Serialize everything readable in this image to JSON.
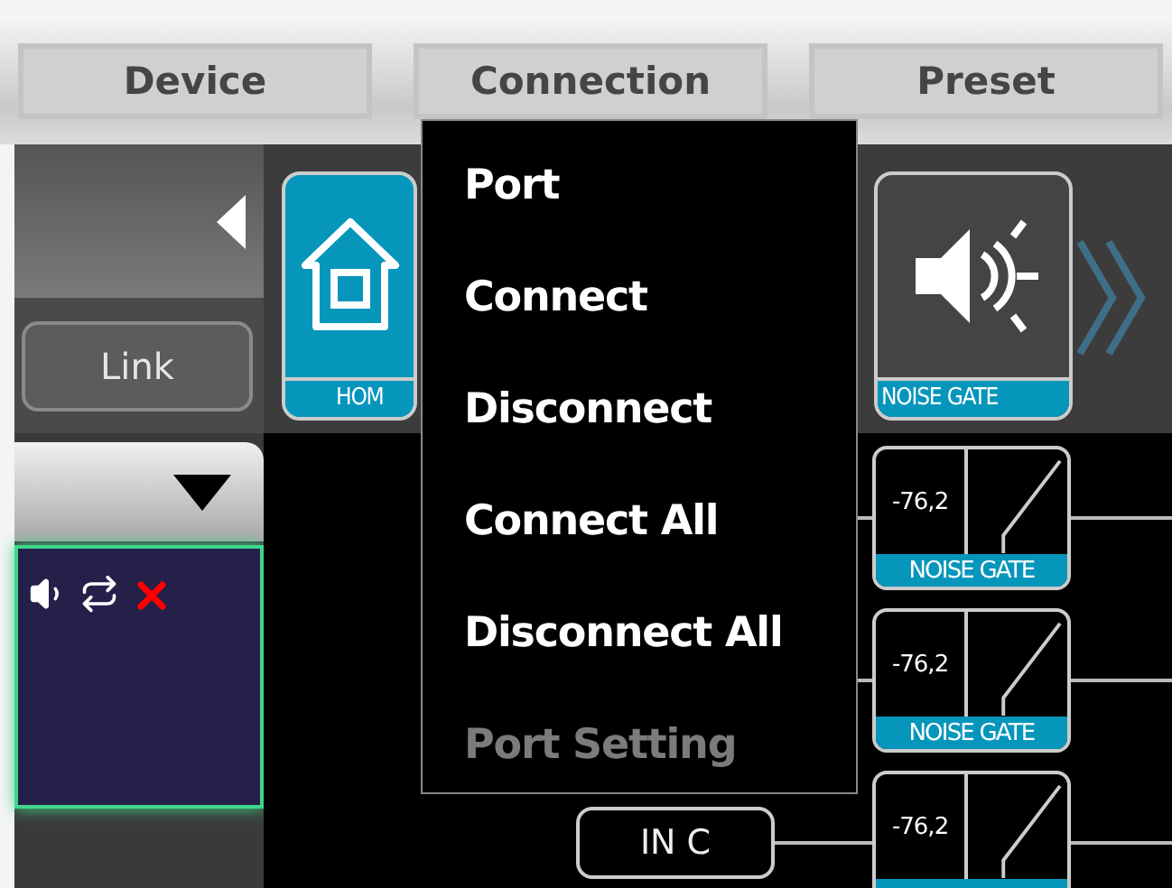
{
  "menubar": [
    {
      "label": "Device"
    },
    {
      "label": "Connection"
    },
    {
      "label": "Preset"
    }
  ],
  "dropdown": [
    {
      "label": "Port",
      "disabled": false
    },
    {
      "label": "Connect",
      "disabled": false
    },
    {
      "label": "Disconnect",
      "disabled": false
    },
    {
      "label": "Connect All",
      "disabled": false
    },
    {
      "label": "Disconnect All",
      "disabled": false
    },
    {
      "label": "Port Setting",
      "disabled": true
    }
  ],
  "left_panel": {
    "link_button": "Link"
  },
  "modules": [
    {
      "kind": "home",
      "label": "HOM"
    },
    {
      "kind": "noise-gate",
      "label": "NOISE GATE"
    }
  ],
  "channel_blocks": [
    {
      "value": "-76,2",
      "label": "NOISE GATE"
    },
    {
      "value": "-76,2",
      "label": "NOISE GATE"
    },
    {
      "value": "-76,2"
    }
  ],
  "input_button": "IN C"
}
